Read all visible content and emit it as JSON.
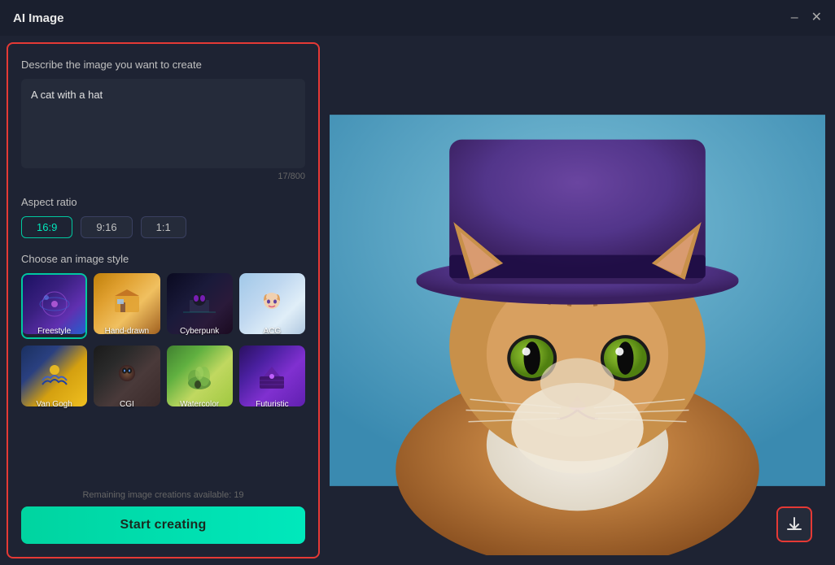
{
  "window": {
    "title": "AI Image",
    "minimize_label": "–",
    "close_label": "✕"
  },
  "left_panel": {
    "prompt_label": "Describe the image you want to create",
    "prompt_value": "A cat with a hat",
    "char_count": "17/800",
    "aspect_ratio_label": "Aspect ratio",
    "aspect_options": [
      {
        "label": "16:9",
        "active": true
      },
      {
        "label": "9:16",
        "active": false
      },
      {
        "label": "1:1",
        "active": false
      }
    ],
    "style_label": "Choose an image style",
    "styles": [
      {
        "id": "freestyle",
        "label": "Freestyle",
        "active": true
      },
      {
        "id": "handdrawn",
        "label": "Hand-drawn",
        "active": false
      },
      {
        "id": "cyberpunk",
        "label": "Cyberpunk",
        "active": false
      },
      {
        "id": "acg",
        "label": "ACG",
        "active": false
      },
      {
        "id": "vangogh",
        "label": "Van Gogh",
        "active": false
      },
      {
        "id": "cgi",
        "label": "CGI",
        "active": false
      },
      {
        "id": "watercolor",
        "label": "Watercolor",
        "active": false
      },
      {
        "id": "futuristic",
        "label": "Futuristic",
        "active": false
      }
    ],
    "remaining_text": "Remaining image creations available: 19",
    "start_button_label": "Start creating"
  },
  "right_panel": {
    "download_icon": "⬇"
  }
}
